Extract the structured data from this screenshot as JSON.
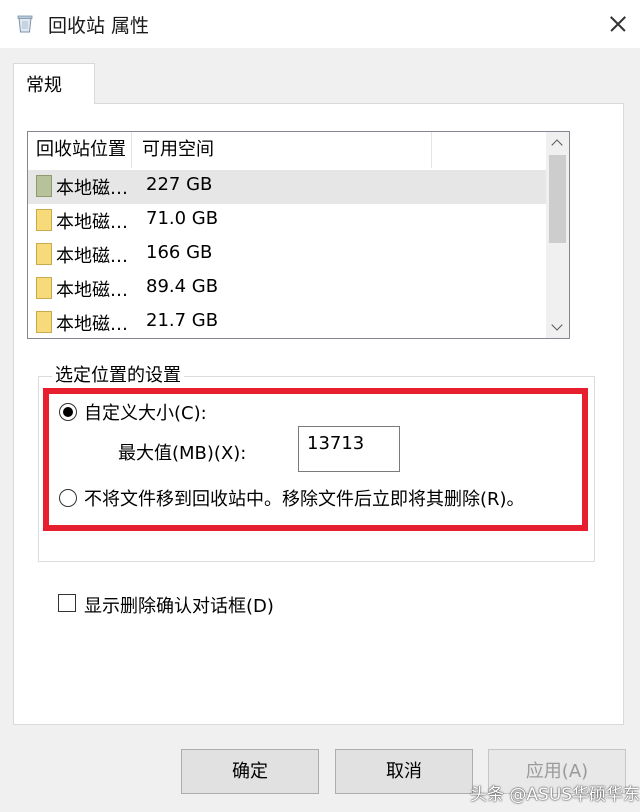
{
  "window": {
    "title": "回收站 属性",
    "icon": "recycle-bin-icon",
    "close_icon": "close-icon"
  },
  "tabs": [
    {
      "label": "常规",
      "active": true
    }
  ],
  "drive_list": {
    "columns": [
      "回收站位置",
      "可用空间"
    ],
    "rows": [
      {
        "name": "本地磁…",
        "size": "227 GB",
        "selected": true
      },
      {
        "name": "本地磁…",
        "size": "71.0 GB",
        "selected": false
      },
      {
        "name": "本地磁…",
        "size": "166 GB",
        "selected": false
      },
      {
        "name": "本地磁…",
        "size": "89.4 GB",
        "selected": false
      },
      {
        "name": "本地磁…",
        "size": "21.7 GB",
        "selected": false
      }
    ]
  },
  "settings": {
    "group_label": "选定位置的设置",
    "custom_size_label": "自定义大小(C):",
    "custom_size_checked": true,
    "max_label": "最大值(MB)(X):",
    "max_value": "13713",
    "no_recycle_label": "不将文件移到回收站中。移除文件后立即将其删除(R)。",
    "no_recycle_checked": false
  },
  "confirm_dialog": {
    "label": "显示删除确认对话框(D)",
    "checked": false
  },
  "buttons": {
    "ok": "确定",
    "cancel": "取消",
    "apply": "应用(A)"
  },
  "watermark": "头条 @ASUS华硕华东",
  "colors": {
    "highlight": "#e61e2e",
    "selected_row": "#e6e6e6"
  }
}
